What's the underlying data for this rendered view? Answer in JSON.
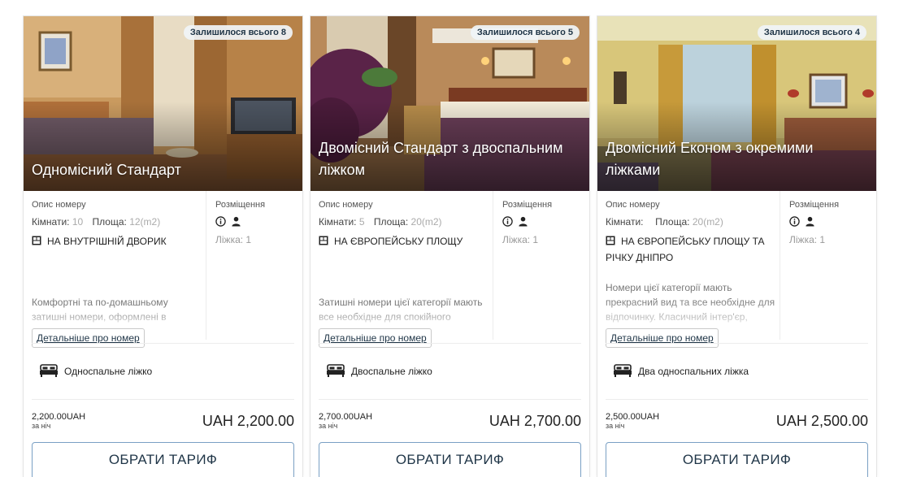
{
  "labels": {
    "description": "Опис номеру",
    "accommodation": "Розміщення",
    "rooms": "Кімнати:",
    "area": "Площа:",
    "more": "Детальніше про номер",
    "per_night": "за ніч",
    "choose": "ОБРАТИ ТАРИФ"
  },
  "icons": {
    "view": "window-view-icon",
    "info": "info-icon",
    "person": "person-icon",
    "bed": "bed-icon"
  },
  "colors": {
    "accent_border": "#7aa0c4",
    "text_dark": "#1f3547"
  },
  "rooms": [
    {
      "remaining": "Залишилося всього 8",
      "title": "Одномісний Стандарт",
      "rooms_count": "10",
      "area": "12(m2)",
      "view": "НА ВНУТРІШНІЙ ДВОРИК",
      "text": "Комфортні та по-домашньому затишні номери, оформлені в",
      "beds": "Ліжка: 1",
      "bed_type": "Односпальне ліжко",
      "price_small": "2,200.00UAH",
      "price": "UAH 2,200.00"
    },
    {
      "remaining": "Залишилося всього 5",
      "title": "Двомісний Стандарт з двоспальним ліжком",
      "rooms_count": "5",
      "area": "20(m2)",
      "view": "НА ЄВРОПЕЙСЬКУ ПЛОЩУ",
      "text": "Затишні номери цієї категорії мають все необхідне для спокійного",
      "beds": "Ліжка: 1",
      "bed_type": "Двоспальне ліжко",
      "price_small": "2,700.00UAH",
      "price": "UAH 2,700.00"
    },
    {
      "remaining": "Залишилося всього 4",
      "title": "Двомісний Економ з окремими ліжками",
      "rooms_count": "",
      "area": "20(m2)",
      "view": "НА ЄВРОПЕЙСЬКУ ПЛОЩУ ТА РІЧКУ ДНІПРО",
      "text": "Номери цієї категорії мають прекрасний вид та все необхідне для відпочинку. Класичний інтер'єр,",
      "beds": "Ліжка: 1",
      "bed_type": "Два односпальних ліжка",
      "price_small": "2,500.00UAH",
      "price": "UAH 2,500.00"
    }
  ]
}
